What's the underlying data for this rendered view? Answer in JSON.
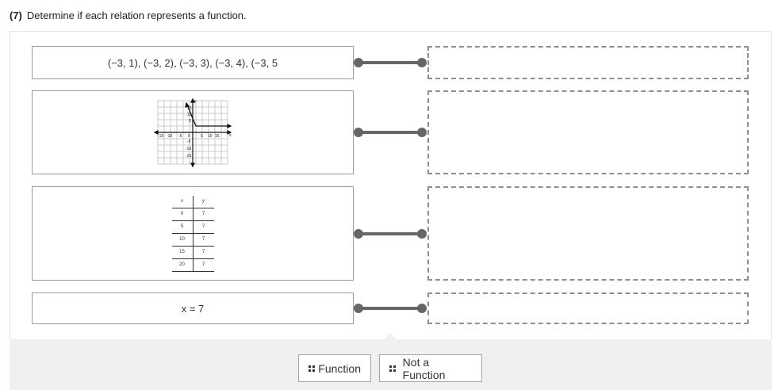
{
  "question": {
    "number": "(7)",
    "text": "Determine if each relation represents a function."
  },
  "prompts": {
    "p1_text": "(−3, 1), (−3, 2), (−3, 3), (−3, 4), (−3, 5",
    "p2_graph": {
      "x_ticks": [
        "-15",
        "-10",
        "-5",
        "5",
        "10",
        "15"
      ],
      "y_ticks": [
        "15",
        "10",
        "5",
        "-5",
        "-10",
        "-15"
      ],
      "x_axis_label": "x",
      "y_axis_label": "y",
      "origin_label": "0"
    },
    "p3_table": {
      "headers": [
        "x",
        "y"
      ],
      "rows": [
        [
          "0",
          "7"
        ],
        [
          "5",
          "7"
        ],
        [
          "10",
          "7"
        ],
        [
          "15",
          "7"
        ],
        [
          "20",
          "7"
        ]
      ]
    },
    "p4_text": "x = 7"
  },
  "choices": {
    "function": "Function",
    "not_function": "Not a Function"
  },
  "colors": {
    "connector": "#666666",
    "tray": "#f0f0f0",
    "border": "#9a9a9a"
  },
  "icons": {
    "chip_grip": "drag-grip-icon"
  }
}
